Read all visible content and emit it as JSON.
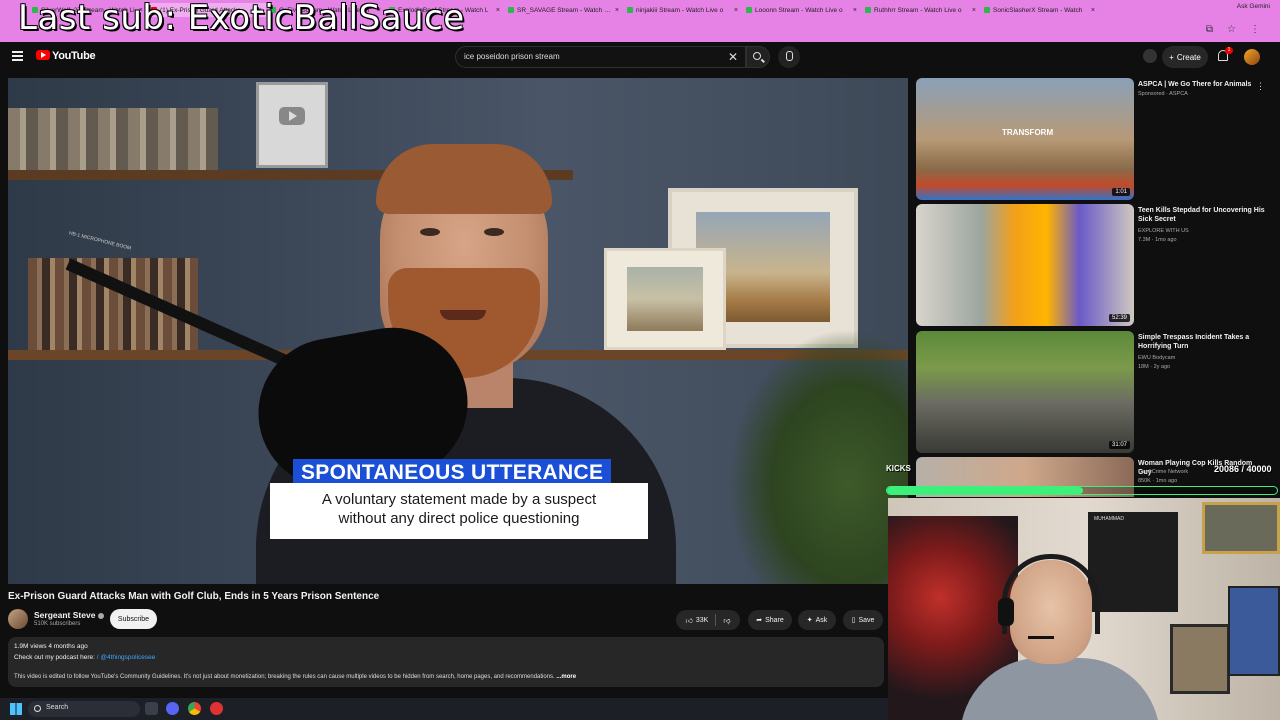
{
  "overlay": {
    "last_sub_text": "Last sub: ExoticBallSauce"
  },
  "browser": {
    "tabs": [
      {
        "title": "SilverWolf_27 Stream - Watch Li",
        "kind": "stream"
      },
      {
        "title": "(1) Ex-Prison Guard Attacks",
        "kind": "youtube"
      },
      {
        "title": "OsFive Stream - Watch Live on",
        "kind": "stream"
      },
      {
        "title": "ExplodinBeef Stream - Watch L",
        "kind": "stream"
      },
      {
        "title": "SR_SAVAGE Stream - Watch Liv",
        "kind": "stream"
      },
      {
        "title": "ninjakiii Stream - Watch Live o",
        "kind": "stream"
      },
      {
        "title": "Looonn Stream - Watch Live o",
        "kind": "stream"
      },
      {
        "title": "Ruthhrr Stream - Watch Live o",
        "kind": "stream"
      },
      {
        "title": "SonicSlasherX Stream - Watch",
        "kind": "stream"
      }
    ],
    "profile_label": "Ask Gemini"
  },
  "youtube": {
    "logo_text": "YouTube",
    "search_value": "ice poseidon prison stream",
    "create_label": "Create",
    "notification_count": "1"
  },
  "video": {
    "caption_title": "SPONTANEOUS UTTERANCE",
    "caption_line1": "A voluntary statement made by a suspect",
    "caption_line2": "without any direct police questioning",
    "mic_label": "HB-1 MICROPHONE BOOM",
    "title": "Ex-Prison Guard Attacks Man with Golf Club, Ends in 5 Years Prison Sentence",
    "channel": "Sergeant Steve",
    "subscribers": "510K subscribers",
    "subscribe_label": "Subscribe",
    "likes": "33K",
    "share_label": "Share",
    "ask_label": "Ask",
    "save_label": "Save",
    "views_date": "1.9M views  4 months ago",
    "podcast_prefix": "Check out my podcast here: ",
    "podcast_link": "/ @4thingspolicesee",
    "description": "This video is edited to follow YouTube's Community Guidelines. It's not just about monetization; breaking the rules can cause multiple videos to be hidden from search, home pages, and recommendations. ",
    "more_label": "...more"
  },
  "recommendations": [
    {
      "title": "ASPCA | We Go There for Animals",
      "channel": "Sponsored · ASPCA",
      "meta": "",
      "duration": "1:01",
      "thumb_text": "TRANSFORM"
    },
    {
      "title": "Teen Kills Stepdad for Uncovering His Sick Secret",
      "channel": "EXPLORE WITH US",
      "meta": "7.3M · 1mo ago",
      "duration": "52:39",
      "thumb_text": ""
    },
    {
      "title": "Simple Trespass Incident Takes a Horrifying Turn",
      "channel": "EWU Bodycam",
      "meta": "18M · 2y ago",
      "duration": "31:07",
      "thumb_text": ""
    },
    {
      "title": "Woman Playing Cop Kills Random Guy",
      "channel": "Law&Crime Network",
      "meta": "850K · 1mo ago",
      "duration": "",
      "thumb_text": ""
    }
  ],
  "kicks": {
    "label": "KICKS",
    "count": "20086 / 40000",
    "progress": 0.502
  },
  "webcam": {
    "banner_text": "MUHAMMAD"
  },
  "taskbar": {
    "search_label": "Search"
  },
  "colors": {
    "accent_red": "#ff0000",
    "caption_blue": "#1a4fd6",
    "kicks_green": "#3cf07a",
    "overlay_pink": "#e682e6"
  }
}
